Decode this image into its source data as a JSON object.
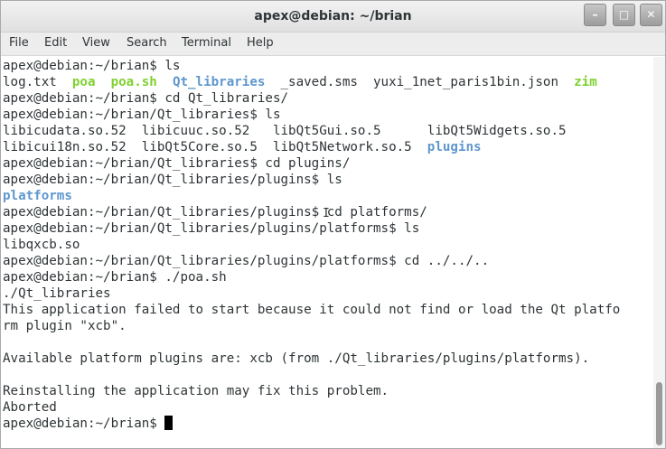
{
  "window": {
    "title": "apex@debian: ~/brian"
  },
  "window_controls": {
    "minimize": "–",
    "maximize": "□",
    "close": "✕"
  },
  "menu": [
    "File",
    "Edit",
    "View",
    "Search",
    "Terminal",
    "Help"
  ],
  "terminal": {
    "lines": [
      [
        {
          "t": "apex@debian:~/brian$ ls"
        }
      ],
      [
        {
          "t": "log.txt  "
        },
        {
          "t": "poa",
          "c": "exe"
        },
        {
          "t": "  "
        },
        {
          "t": "poa.sh",
          "c": "exe"
        },
        {
          "t": "  "
        },
        {
          "t": "Qt_libraries",
          "c": "dir"
        },
        {
          "t": "  _saved.sms  yuxi_1net_paris1bin.json  "
        },
        {
          "t": "zim",
          "c": "exe"
        }
      ],
      [
        {
          "t": "apex@debian:~/brian$ cd Qt_libraries/"
        }
      ],
      [
        {
          "t": "apex@debian:~/brian/Qt_libraries$ ls"
        }
      ],
      [
        {
          "t": "libicudata.so.52  libicuuc.so.52   libQt5Gui.so.5      libQt5Widgets.so.5"
        }
      ],
      [
        {
          "t": "libicui18n.so.52  libQt5Core.so.5  libQt5Network.so.5  "
        },
        {
          "t": "plugins",
          "c": "dir"
        }
      ],
      [
        {
          "t": "apex@debian:~/brian/Qt_libraries$ cd plugins/"
        }
      ],
      [
        {
          "t": "apex@debian:~/brian/Qt_libraries/plugins$ ls"
        }
      ],
      [
        {
          "t": "platforms",
          "c": "dir"
        }
      ],
      [
        {
          "t": "apex@debian:~/brian/Qt_libraries/plugins$ cd platforms/"
        }
      ],
      [
        {
          "t": "apex@debian:~/brian/Qt_libraries/plugins/platforms$ ls"
        }
      ],
      [
        {
          "t": "libqxcb.so"
        }
      ],
      [
        {
          "t": "apex@debian:~/brian/Qt_libraries/plugins/platforms$ cd ../../.."
        }
      ],
      [
        {
          "t": "apex@debian:~/brian$ ./poa.sh"
        }
      ],
      [
        {
          "t": "./Qt_libraries"
        }
      ],
      [
        {
          "t": "This application failed to start because it could not find or load the Qt platfo"
        }
      ],
      [
        {
          "t": "rm plugin \"xcb\"."
        }
      ],
      [
        {
          "t": ""
        }
      ],
      [
        {
          "t": "Available platform plugins are: xcb (from ./Qt_libraries/plugins/platforms)."
        }
      ],
      [
        {
          "t": ""
        }
      ],
      [
        {
          "t": "Reinstalling the application may fix this problem."
        }
      ],
      [
        {
          "t": "Aborted"
        }
      ],
      [
        {
          "t": "apex@debian:~/brian$ "
        }
      ]
    ]
  }
}
